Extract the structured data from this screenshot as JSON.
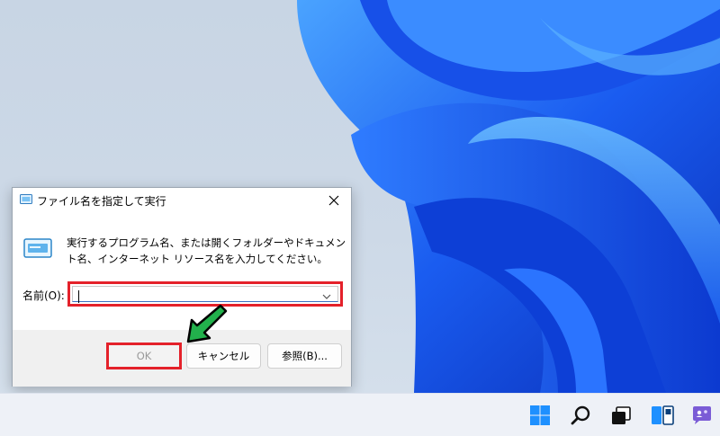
{
  "dialog": {
    "title": "ファイル名を指定して実行",
    "description": "実行するプログラム名、または開くフォルダーやドキュメント名、インターネット リソース名を入力してください。",
    "name_label": "名前(O):",
    "name_value": "",
    "buttons": {
      "ok": "OK",
      "cancel": "キャンセル",
      "browse": "参照(B)..."
    }
  },
  "taskbar": {
    "icons": [
      "windows-start-icon",
      "search-icon",
      "task-view-icon",
      "widgets-icon",
      "chat-icon"
    ]
  },
  "colors": {
    "highlight_box": "#e4212a",
    "pointer_arrow": "#22b14c",
    "wallpaper_blue": "#1a5cf0"
  }
}
